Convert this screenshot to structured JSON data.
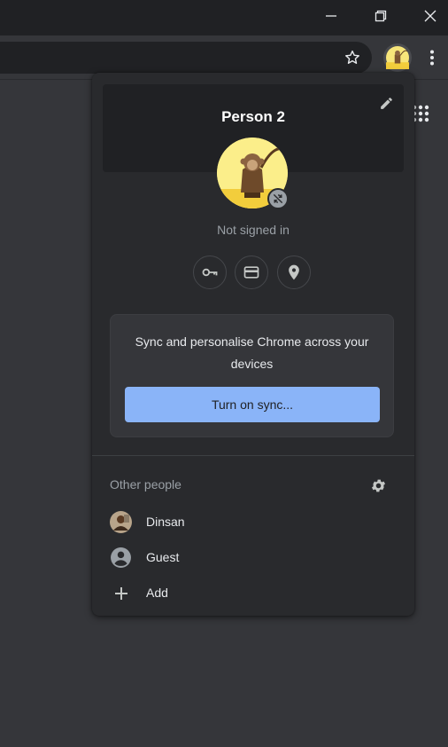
{
  "window": {
    "controls": [
      "minimize-icon",
      "restore-icon",
      "close-icon"
    ]
  },
  "toolbar": {
    "icons": [
      "star-icon",
      "profile-avatar",
      "more-vert-icon"
    ]
  },
  "content": {
    "icons": [
      "apps-grid-icon"
    ]
  },
  "profile_menu": {
    "person_name": "Person 2",
    "status": "Not signed in",
    "quick_actions": [
      {
        "name": "passwords",
        "icon": "key-icon"
      },
      {
        "name": "payment-methods",
        "icon": "credit-card-icon"
      },
      {
        "name": "addresses",
        "icon": "location-pin-icon"
      }
    ],
    "sync_card": {
      "message": "Sync and personalise Chrome across your devices",
      "button_label": "Turn on sync..."
    },
    "other_people": {
      "title": "Other people",
      "people": [
        {
          "label": "Dinsan",
          "icon": "person-avatar-photo"
        },
        {
          "label": "Guest",
          "icon": "account-circle-icon"
        },
        {
          "label": "Add",
          "icon": "plus-icon"
        }
      ]
    }
  },
  "colors": {
    "accent": "#8ab4f8",
    "menu_bg": "#292a2d",
    "header_bg": "#202124",
    "avatar_bg": "#f7e57a"
  }
}
